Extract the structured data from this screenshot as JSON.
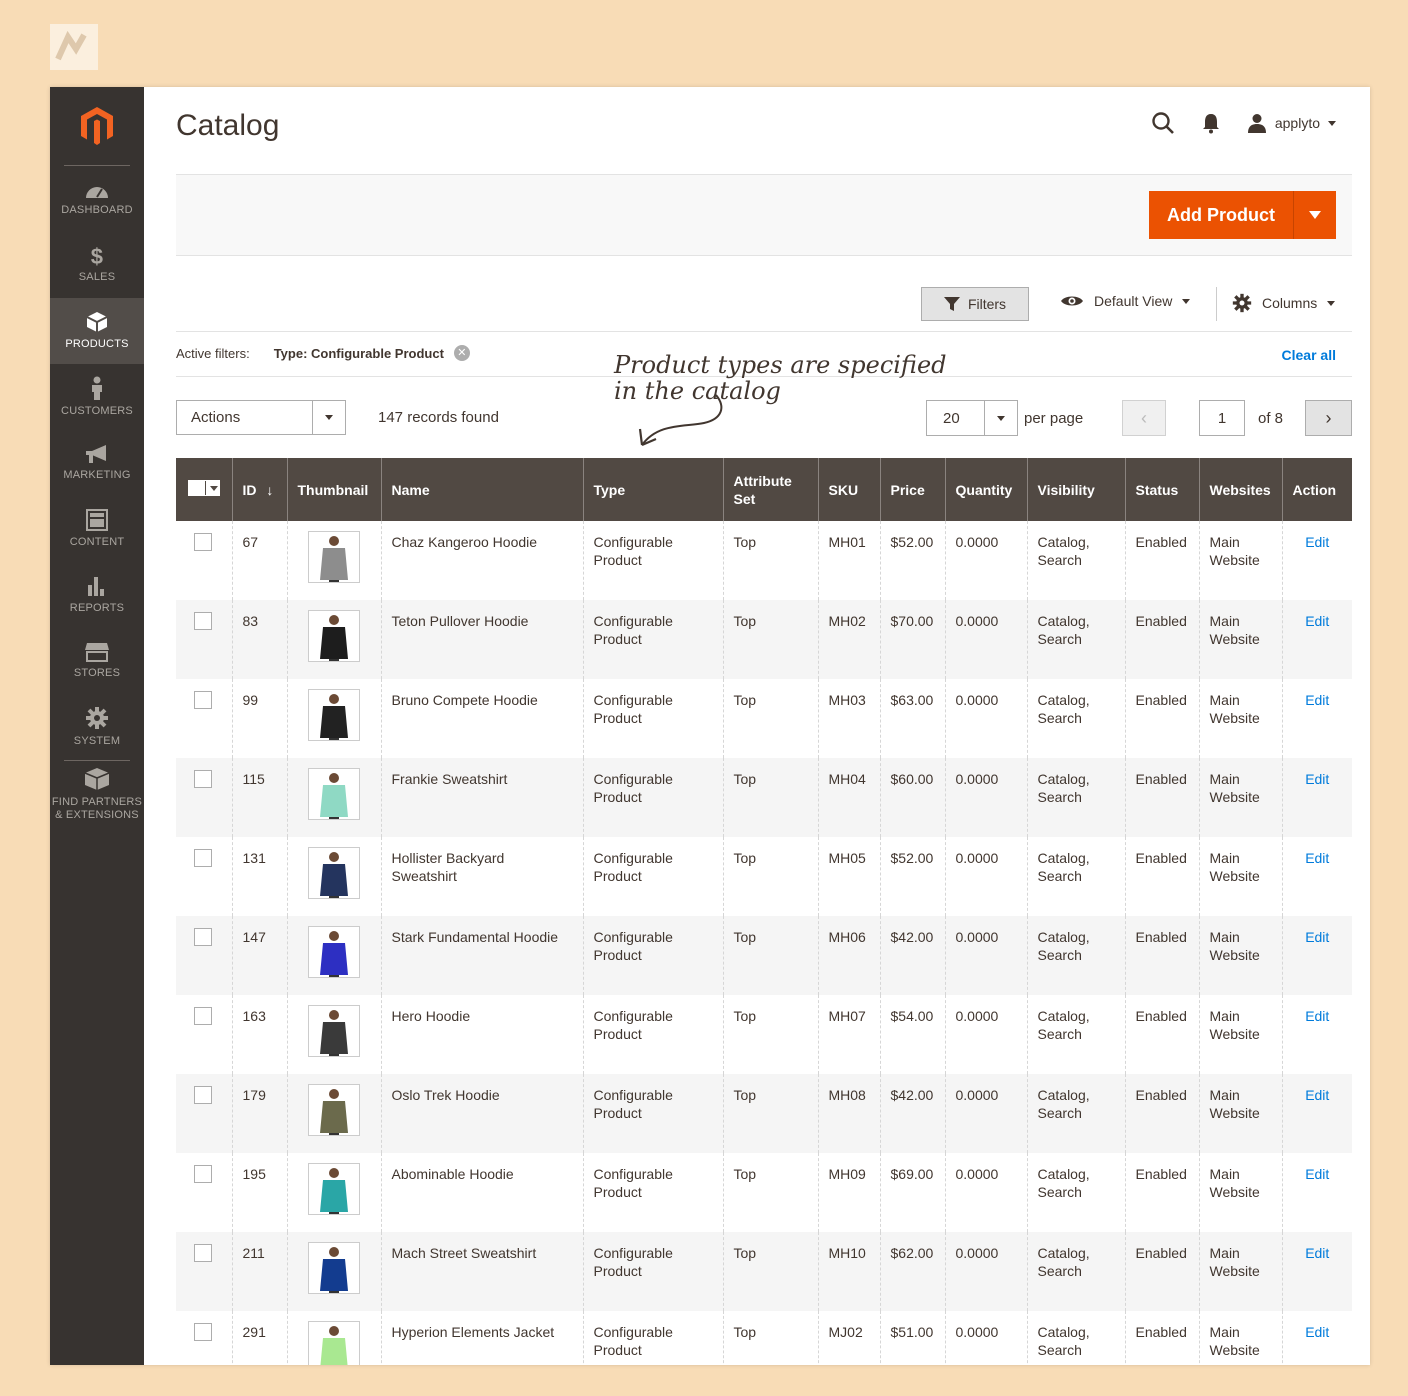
{
  "colors": {
    "sidebar": "#373330",
    "accent": "#eb5202",
    "link": "#007bdb",
    "grid_header": "#514943",
    "backdrop": "#f8dcb6"
  },
  "sidebar": {
    "items": [
      {
        "label": "DASHBOARD",
        "icon": "dashboard-icon"
      },
      {
        "label": "SALES",
        "icon": "dollar-icon"
      },
      {
        "label": "PRODUCTS",
        "icon": "cube-icon"
      },
      {
        "label": "CUSTOMERS",
        "icon": "person-icon"
      },
      {
        "label": "MARKETING",
        "icon": "megaphone-icon"
      },
      {
        "label": "CONTENT",
        "icon": "layout-icon"
      },
      {
        "label": "REPORTS",
        "icon": "bar-chart-icon"
      },
      {
        "label": "STORES",
        "icon": "store-icon"
      },
      {
        "label": "SYSTEM",
        "icon": "gear-icon"
      }
    ],
    "partners": {
      "line1": "FIND PARTNERS",
      "line2": "& EXTENSIONS",
      "icon": "box-icon"
    }
  },
  "header": {
    "title": "Catalog",
    "user": "applyto"
  },
  "action_bar": {
    "add_product_label": "Add Product"
  },
  "toolbar": {
    "filters_label": "Filters",
    "view_label": "Default View",
    "columns_label": "Columns"
  },
  "active_filters": {
    "label": "Active filters:",
    "tag": "Type: Configurable Product",
    "clear_all": "Clear all"
  },
  "annotation": {
    "line1": "Product types are specified",
    "line2": "in the catalog"
  },
  "grid_controls": {
    "actions_label": "Actions",
    "records_found": "147 records found",
    "per_page_value": "20",
    "per_page_label": "per page",
    "current_page": "1",
    "of_pages": "of 8"
  },
  "columns": {
    "id": "ID",
    "thumbnail": "Thumbnail",
    "name": "Name",
    "type": "Type",
    "attribute_set": "Attribute Set",
    "sku": "SKU",
    "price": "Price",
    "quantity": "Quantity",
    "visibility": "Visibility",
    "status": "Status",
    "websites": "Websites",
    "action": "Action"
  },
  "rows": [
    {
      "id": "67",
      "name": "Chaz Kangeroo Hoodie",
      "type1": "Configurable",
      "type2": "Product",
      "attr": "Top",
      "sku": "MH01",
      "price": "$52.00",
      "qty": "0.0000",
      "vis1": "Catalog,",
      "vis2": "Search",
      "status": "Enabled",
      "web1": "Main",
      "web2": "Website",
      "action": "Edit",
      "shirt_color": "#8d8d8d"
    },
    {
      "id": "83",
      "name": "Teton Pullover Hoodie",
      "type1": "Configurable",
      "type2": "Product",
      "attr": "Top",
      "sku": "MH02",
      "price": "$70.00",
      "qty": "0.0000",
      "vis1": "Catalog,",
      "vis2": "Search",
      "status": "Enabled",
      "web1": "Main",
      "web2": "Website",
      "action": "Edit",
      "shirt_color": "#1d1d1d"
    },
    {
      "id": "99",
      "name": "Bruno Compete Hoodie",
      "type1": "Configurable",
      "type2": "Product",
      "attr": "Top",
      "sku": "MH03",
      "price": "$63.00",
      "qty": "0.0000",
      "vis1": "Catalog,",
      "vis2": "Search",
      "status": "Enabled",
      "web1": "Main",
      "web2": "Website",
      "action": "Edit",
      "shirt_color": "#222222"
    },
    {
      "id": "115",
      "name": "Frankie Sweatshirt",
      "type1": "Configurable",
      "type2": "Product",
      "attr": "Top",
      "sku": "MH04",
      "price": "$60.00",
      "qty": "0.0000",
      "vis1": "Catalog,",
      "vis2": "Search",
      "status": "Enabled",
      "web1": "Main",
      "web2": "Website",
      "action": "Edit",
      "shirt_color": "#8fd9c4"
    },
    {
      "id": "131",
      "name": "Hollister Backyard Sweatshirt",
      "type1": "Configurable",
      "type2": "Product",
      "attr": "Top",
      "sku": "MH05",
      "price": "$52.00",
      "qty": "0.0000",
      "vis1": "Catalog,",
      "vis2": "Search",
      "status": "Enabled",
      "web1": "Main",
      "web2": "Website",
      "action": "Edit",
      "shirt_color": "#24345e"
    },
    {
      "id": "147",
      "name": "Stark Fundamental Hoodie",
      "type1": "Configurable",
      "type2": "Product",
      "attr": "Top",
      "sku": "MH06",
      "price": "$42.00",
      "qty": "0.0000",
      "vis1": "Catalog,",
      "vis2": "Search",
      "status": "Enabled",
      "web1": "Main",
      "web2": "Website",
      "action": "Edit",
      "shirt_color": "#2d2fc2"
    },
    {
      "id": "163",
      "name": "Hero Hoodie",
      "type1": "Configurable",
      "type2": "Product",
      "attr": "Top",
      "sku": "MH07",
      "price": "$54.00",
      "qty": "0.0000",
      "vis1": "Catalog,",
      "vis2": "Search",
      "status": "Enabled",
      "web1": "Main",
      "web2": "Website",
      "action": "Edit",
      "shirt_color": "#3a3a3a"
    },
    {
      "id": "179",
      "name": "Oslo Trek Hoodie",
      "type1": "Configurable",
      "type2": "Product",
      "attr": "Top",
      "sku": "MH08",
      "price": "$42.00",
      "qty": "0.0000",
      "vis1": "Catalog,",
      "vis2": "Search",
      "status": "Enabled",
      "web1": "Main",
      "web2": "Website",
      "action": "Edit",
      "shirt_color": "#6b6a4c"
    },
    {
      "id": "195",
      "name": "Abominable Hoodie",
      "type1": "Configurable",
      "type2": "Product",
      "attr": "Top",
      "sku": "MH09",
      "price": "$69.00",
      "qty": "0.0000",
      "vis1": "Catalog,",
      "vis2": "Search",
      "status": "Enabled",
      "web1": "Main",
      "web2": "Website",
      "action": "Edit",
      "shirt_color": "#2aa6a6"
    },
    {
      "id": "211",
      "name": "Mach Street Sweatshirt",
      "type1": "Configurable",
      "type2": "Product",
      "attr": "Top",
      "sku": "MH10",
      "price": "$62.00",
      "qty": "0.0000",
      "vis1": "Catalog,",
      "vis2": "Search",
      "status": "Enabled",
      "web1": "Main",
      "web2": "Website",
      "action": "Edit",
      "shirt_color": "#133c8f"
    },
    {
      "id": "291",
      "name": "Hyperion Elements Jacket",
      "type1": "Configurable",
      "type2": "Product",
      "attr": "Top",
      "sku": "MJ02",
      "price": "$51.00",
      "qty": "0.0000",
      "vis1": "Catalog,",
      "vis2": "Search",
      "status": "Enabled",
      "web1": "Main",
      "web2": "Website",
      "action": "Edit",
      "shirt_color": "#a9e891"
    }
  ]
}
